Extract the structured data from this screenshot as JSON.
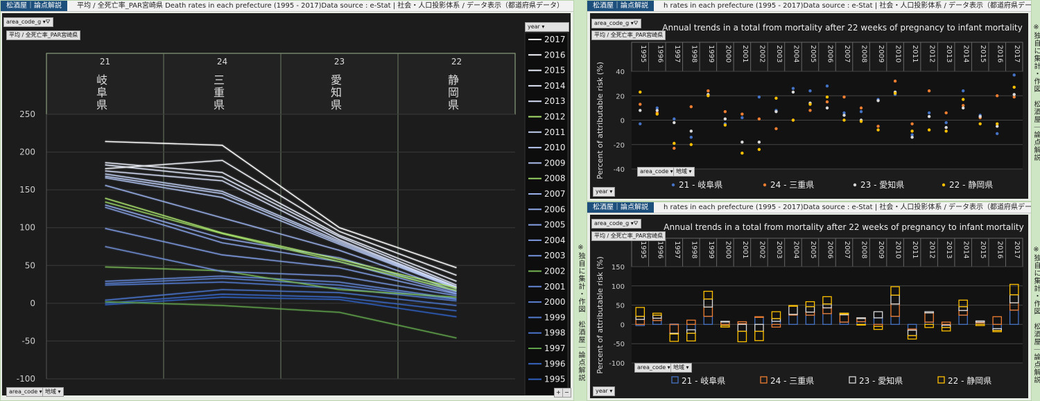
{
  "header": {
    "brand": "松酒屋｜論点解説",
    "left_title": "平均 / 全死亡率_PAR宮崎県     Death rates in each prefecture (1995 - 2017)Data source : e-Stat | 社会・人口投影体系 / データ表示（都道府県データ）",
    "right_title": "h rates in each prefecture (1995 - 2017)Data source : e-Stat | 社会・人口投影体系 / データ表示（都道府県データ）"
  },
  "side_text": "※独自に集計・作図　松酒屋｜論点解説",
  "controls": {
    "area_code_g": "area_code_g",
    "measure": "平均 / 全死亡率_PAR宮崎県",
    "area_code": "area_code",
    "region": "地域",
    "year": "year",
    "plus": "+",
    "minus": "−"
  },
  "colors": {
    "background": "#191919",
    "gifu": "#4472c4",
    "mie": "#ed7d31",
    "aichi": "#d9d9d9",
    "shizuoka": "#ffc000"
  },
  "chart_data": [
    {
      "type": "line",
      "categories": [
        "21",
        "24",
        "23",
        "22"
      ],
      "category_names": [
        "岐阜県",
        "三重県",
        "愛知県",
        "静岡県"
      ],
      "ylim": [
        -100,
        250
      ],
      "yticks": [
        250,
        200,
        150,
        100,
        50,
        0,
        -50,
        -100
      ],
      "legend_title": "year",
      "series": [
        {
          "name": "2017",
          "values": [
            214,
            209,
            100,
            47
          ]
        },
        {
          "name": "2016",
          "values": [
            178,
            189,
            95,
            37
          ]
        },
        {
          "name": "2015",
          "values": [
            186,
            173,
            90,
            29
          ]
        },
        {
          "name": "2014",
          "values": [
            183,
            167,
            88,
            24
          ]
        },
        {
          "name": "2013",
          "values": [
            175,
            162,
            84,
            22
          ]
        },
        {
          "name": "2012",
          "values": [
            139,
            93,
            58,
            20
          ]
        },
        {
          "name": "2011",
          "values": [
            171,
            148,
            82,
            21
          ]
        },
        {
          "name": "2010",
          "values": [
            168,
            145,
            80,
            20
          ]
        },
        {
          "name": "2009",
          "values": [
            166,
            140,
            78,
            19
          ]
        },
        {
          "name": "2008",
          "values": [
            134,
            92,
            55,
            17
          ]
        },
        {
          "name": "2007",
          "values": [
            156,
            113,
            70,
            16
          ]
        },
        {
          "name": "2006",
          "values": [
            130,
            86,
            60,
            15
          ]
        },
        {
          "name": "2005",
          "values": [
            127,
            80,
            55,
            13
          ]
        },
        {
          "name": "2004",
          "values": [
            99,
            64,
            47,
            12
          ]
        },
        {
          "name": "2003",
          "values": [
            75,
            42,
            36,
            10
          ]
        },
        {
          "name": "2002",
          "values": [
            48,
            43,
            18,
            8
          ]
        },
        {
          "name": "2001",
          "values": [
            29,
            36,
            28,
            6
          ]
        },
        {
          "name": "2000",
          "values": [
            26,
            33,
            24,
            5
          ]
        },
        {
          "name": "1999",
          "values": [
            24,
            28,
            20,
            3
          ]
        },
        {
          "name": "1998",
          "values": [
            4,
            18,
            14,
            -3
          ]
        },
        {
          "name": "1997",
          "values": [
            2,
            -3,
            -12,
            -46
          ]
        },
        {
          "name": "1996",
          "values": [
            0,
            12,
            8,
            -10
          ]
        },
        {
          "name": "1995",
          "values": [
            -2,
            8,
            5,
            -18
          ]
        }
      ]
    },
    {
      "type": "scatter",
      "title": "Annual trends in a total from mortality after 22 weeks of pregnancy to infant mortality",
      "ylabel": "Percent of attributable risk (%)",
      "ylim": [
        -40,
        40
      ],
      "yticks": [
        40,
        20,
        0,
        -20,
        -40
      ],
      "categories": [
        "1995",
        "1996",
        "1997",
        "1998",
        "1999",
        "2000",
        "2001",
        "2002",
        "2003",
        "2004",
        "2005",
        "2006",
        "2007",
        "2008",
        "2009",
        "2010",
        "2011",
        "2012",
        "2013",
        "2014",
        "2015",
        "2016",
        "2017"
      ],
      "series": [
        {
          "name": "21 - 岐阜県",
          "values": [
            -3,
            10,
            1,
            -14,
            21,
            -3,
            2,
            19,
            8,
            26,
            24,
            28,
            6,
            7,
            17,
            21,
            -12,
            6,
            -2,
            24,
            4,
            -11,
            37
          ]
        },
        {
          "name": "24 - 三重県",
          "values": [
            13,
            6,
            -23,
            11,
            24,
            7,
            5,
            1,
            -7,
            0,
            8,
            15,
            19,
            10,
            -5,
            32,
            -3,
            24,
            6,
            12,
            2,
            20,
            19
          ]
        },
        {
          "name": "23 - 愛知県",
          "values": [
            8,
            8,
            -2,
            -9,
            21,
            1,
            -18,
            -18,
            7,
            23,
            14,
            10,
            4,
            0,
            16,
            23,
            -14,
            3,
            -6,
            10,
            3,
            -5,
            21
          ]
        },
        {
          "name": "22 - 静岡県",
          "values": [
            23,
            5,
            -19,
            -20,
            20,
            -4,
            -27,
            -24,
            18,
            0,
            13,
            19,
            0,
            -1,
            -8,
            22,
            -9,
            -8,
            -9,
            17,
            -3,
            -3,
            27
          ]
        }
      ]
    },
    {
      "type": "bar",
      "title": "Annual trends in a total from mortality after 22 weeks of pregnancy to infant mortality",
      "ylabel": "Percent of attributable risk (%)",
      "ylim": [
        -100,
        150
      ],
      "yticks": [
        150,
        100,
        50,
        0,
        -50,
        -100
      ],
      "stacked": true,
      "categories": [
        "1995",
        "1996",
        "1997",
        "1998",
        "1999",
        "2000",
        "2001",
        "2002",
        "2003",
        "2004",
        "2005",
        "2006",
        "2007",
        "2008",
        "2009",
        "2010",
        "2011",
        "2012",
        "2013",
        "2014",
        "2015",
        "2016",
        "2017"
      ],
      "series": [
        {
          "name": "21 - 岐阜県",
          "values": [
            -3,
            10,
            1,
            -14,
            21,
            -3,
            2,
            19,
            8,
            26,
            24,
            28,
            6,
            7,
            17,
            21,
            -12,
            6,
            -2,
            24,
            4,
            -11,
            37
          ]
        },
        {
          "name": "24 - 三重県",
          "values": [
            13,
            6,
            -23,
            11,
            24,
            7,
            5,
            1,
            -7,
            0,
            8,
            15,
            19,
            10,
            -5,
            32,
            -3,
            24,
            6,
            12,
            2,
            20,
            19
          ]
        },
        {
          "name": "23 - 愛知県",
          "values": [
            8,
            8,
            -2,
            -9,
            21,
            1,
            -18,
            -18,
            7,
            23,
            14,
            10,
            4,
            0,
            16,
            23,
            -14,
            3,
            -6,
            10,
            3,
            -5,
            21
          ]
        },
        {
          "name": "22 - 静岡県",
          "values": [
            23,
            5,
            -19,
            -20,
            20,
            -4,
            -27,
            -24,
            18,
            0,
            13,
            19,
            0,
            -1,
            -8,
            22,
            -9,
            -8,
            -9,
            17,
            -3,
            -3,
            27
          ]
        }
      ]
    }
  ]
}
